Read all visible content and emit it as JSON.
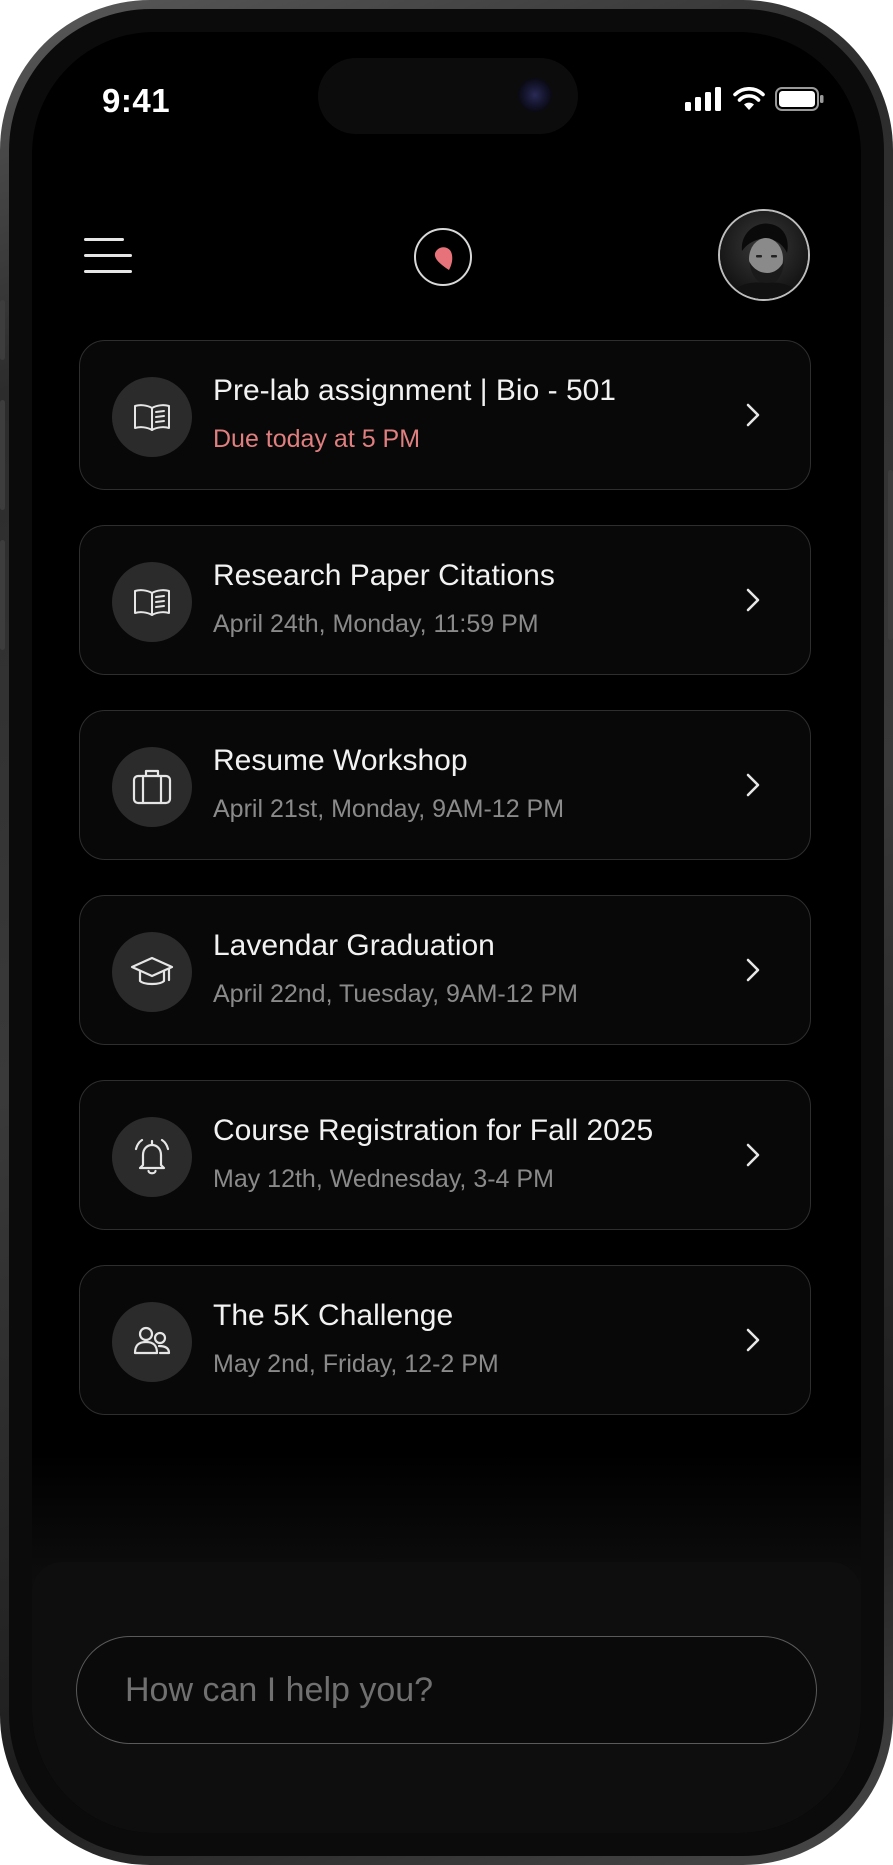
{
  "status_bar": {
    "time": "9:41"
  },
  "header": {
    "menu_icon": "hamburger-menu-icon",
    "logo_icon": "petal-logo-icon",
    "accent_color": "#e8727a"
  },
  "tasks": [
    {
      "title": "Pre-lab assignment | Bio - 501",
      "subtitle": "Due today at 5 PM",
      "icon": "open-book-icon",
      "urgent": true
    },
    {
      "title": "Research Paper Citations",
      "subtitle": "April 24th, Monday, 11:59 PM",
      "icon": "open-book-icon",
      "urgent": false
    },
    {
      "title": "Resume Workshop",
      "subtitle": "April 21st, Monday, 9AM-12 PM",
      "icon": "briefcase-icon",
      "urgent": false
    },
    {
      "title": "Lavendar Graduation",
      "subtitle": "April 22nd, Tuesday, 9AM-12 PM",
      "icon": "graduation-cap-icon",
      "urgent": false
    },
    {
      "title": "Course Registration for Fall 2025",
      "subtitle": "May 12th, Wednesday, 3-4 PM",
      "icon": "alarm-bell-icon",
      "urgent": false
    },
    {
      "title": "The 5K Challenge",
      "subtitle": "May 2nd, Friday, 12-2 PM",
      "icon": "group-icon",
      "urgent": false
    }
  ],
  "chat": {
    "placeholder": "How can I help you?",
    "value": ""
  },
  "colors": {
    "urgent_text": "#e07f7f",
    "secondary_text": "#8a8a8a",
    "primary_text": "#f2f2f2"
  }
}
